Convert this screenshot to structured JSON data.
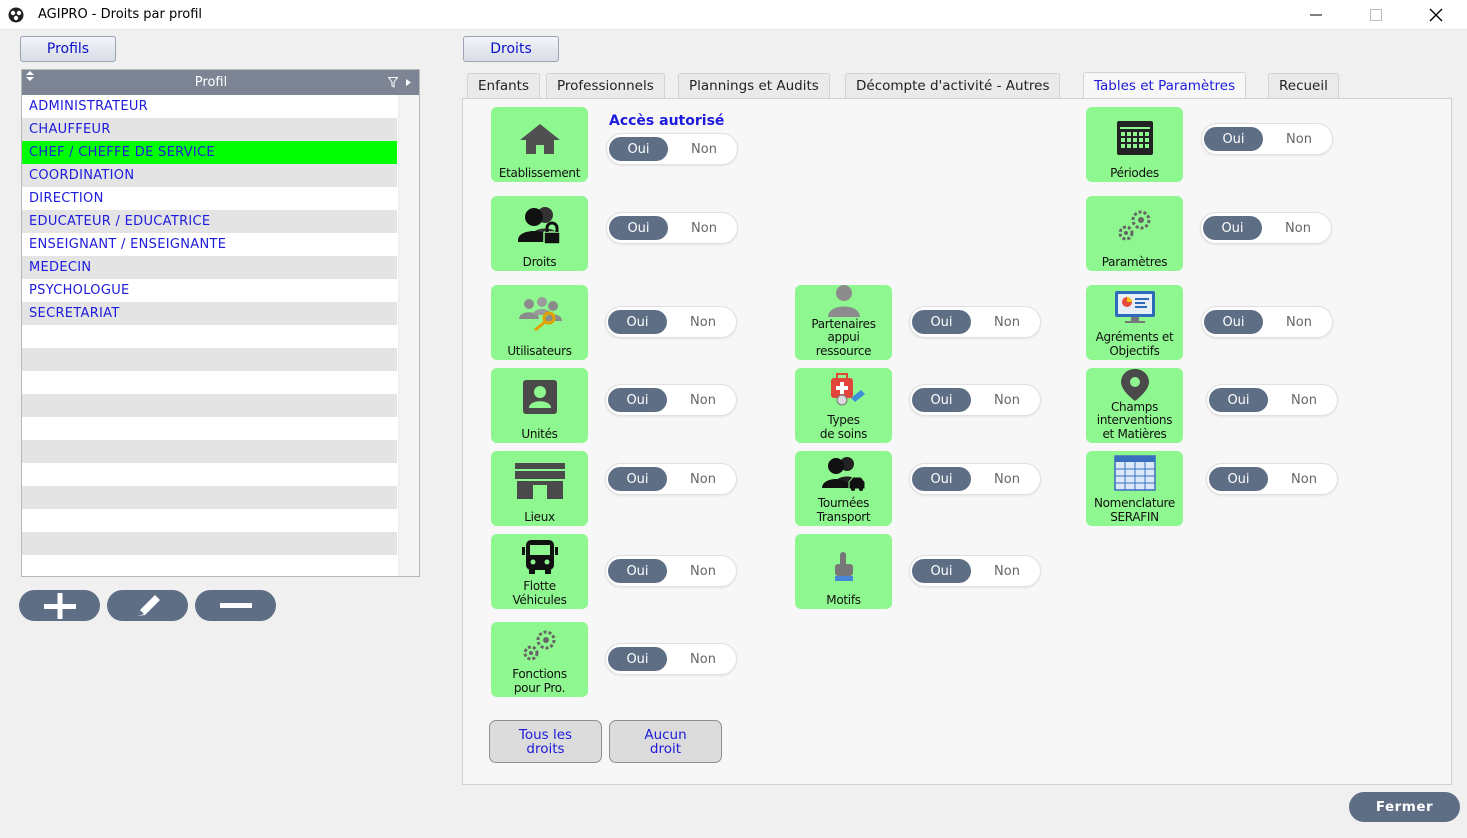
{
  "window": {
    "title": "AGIPRO - Droits par profil"
  },
  "left": {
    "profils_button": "Profils",
    "list": {
      "header": "Profil",
      "items": [
        "ADMINISTRATEUR",
        "CHAUFFEUR",
        "CHEF / CHEFFE DE SERVICE",
        "COORDINATION",
        "DIRECTION",
        "EDUCATEUR / EDUCATRICE",
        "ENSEIGNANT / ENSEIGNANTE",
        "MEDECIN",
        "PSYCHOLOGUE",
        "SECRETARIAT"
      ],
      "selected": "CHEF / CHEFFE DE SERVICE"
    }
  },
  "right": {
    "droits_button": "Droits",
    "tabs": [
      "Enfants",
      "Professionnels",
      "Plannings et Audits",
      "Décompte d'activité - Autres",
      "Tables et Paramètres",
      "Recueil"
    ],
    "active_tab": "Tables et Paramètres",
    "access_label": "Accès autorisé",
    "toggle": {
      "on": "Oui",
      "off": "Non"
    },
    "tiles": {
      "etablissement": "Etablissement",
      "droits": "Droits",
      "utilisateurs": "Utilisateurs",
      "unites": "Unités",
      "lieux": "Lieux",
      "flotte": [
        "Flotte",
        "Véhicules"
      ],
      "fonctions": [
        "Fonctions",
        "pour Pro."
      ],
      "partenaires": [
        "Partenaires",
        "appui",
        "ressource"
      ],
      "types_soins": [
        "Types",
        "de soins"
      ],
      "tournees": [
        "Tournées",
        "Transport"
      ],
      "motifs": "Motifs",
      "periodes": "Périodes",
      "parametres": "Paramètres",
      "agrements": [
        "Agréments et",
        "Objectifs"
      ],
      "champs": [
        "Champs",
        "interventions",
        "et Matières"
      ],
      "nomenclature": [
        "Nomenclature",
        "SERAFIN"
      ]
    },
    "buttons": {
      "all": [
        "Tous les",
        "droits"
      ],
      "none": [
        "Aucun",
        "droit"
      ]
    },
    "close": "Fermer"
  },
  "colors": {
    "accent_text": "#1d1bdc",
    "tile_green": "#8ff78f",
    "toggle_dark": "#5e6e84",
    "selected_row": "#00ff00",
    "list_header": "#7d8594"
  }
}
